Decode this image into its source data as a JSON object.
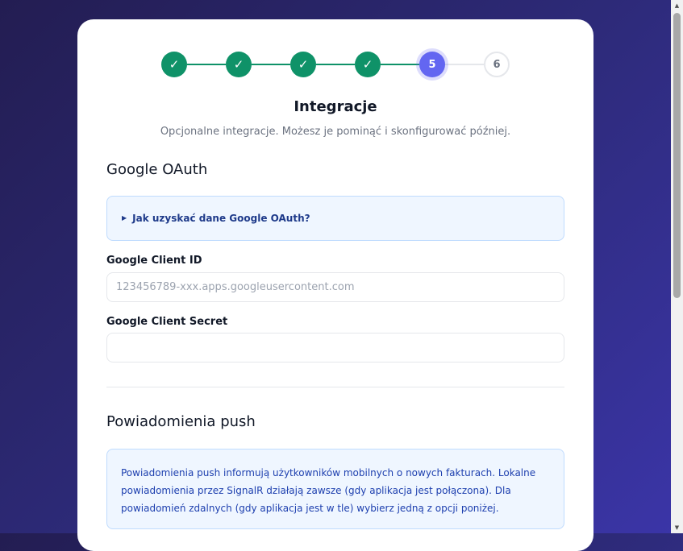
{
  "stepper": {
    "steps": [
      {
        "label": "✓",
        "state": "done"
      },
      {
        "label": "✓",
        "state": "done"
      },
      {
        "label": "✓",
        "state": "done"
      },
      {
        "label": "✓",
        "state": "done"
      },
      {
        "label": "5",
        "state": "current"
      },
      {
        "label": "6",
        "state": "todo"
      }
    ],
    "current_step": 5,
    "total_steps": 6
  },
  "header": {
    "title": "Integracje",
    "subtitle": "Opcjonalne integracje. Możesz je pominąć i skonfigurować później."
  },
  "google": {
    "section_title": "Google OAuth",
    "help_toggle": "Jak uzyskać dane Google OAuth?",
    "client_id_label": "Google Client ID",
    "client_id_placeholder": "123456789-xxx.apps.googleusercontent.com",
    "client_id_value": "",
    "client_secret_label": "Google Client Secret",
    "client_secret_value": ""
  },
  "push": {
    "section_title": "Powiadomienia push",
    "info_line1": "Powiadomienia push informują użytkowników mobilnych o nowych fakturach. Lokalne",
    "info_line2": "powiadomienia przez SignalR działają zawsze (gdy aplikacja jest połączona). Dla",
    "info_line3": "powiadomień zdalnych (gdy aplikacja jest w tle) wybierz jedną z opcji poniżej."
  },
  "colors": {
    "done": "#0f9268",
    "current": "#6366f1",
    "pending_border": "#e5e7eb",
    "info_bg": "#eff6ff",
    "info_text": "#1e40af"
  },
  "icons": {
    "step_done": "check-icon",
    "help_toggle": "triangle-right-icon",
    "scroll_up": "triangle-up-icon",
    "scroll_down": "triangle-down-icon"
  }
}
